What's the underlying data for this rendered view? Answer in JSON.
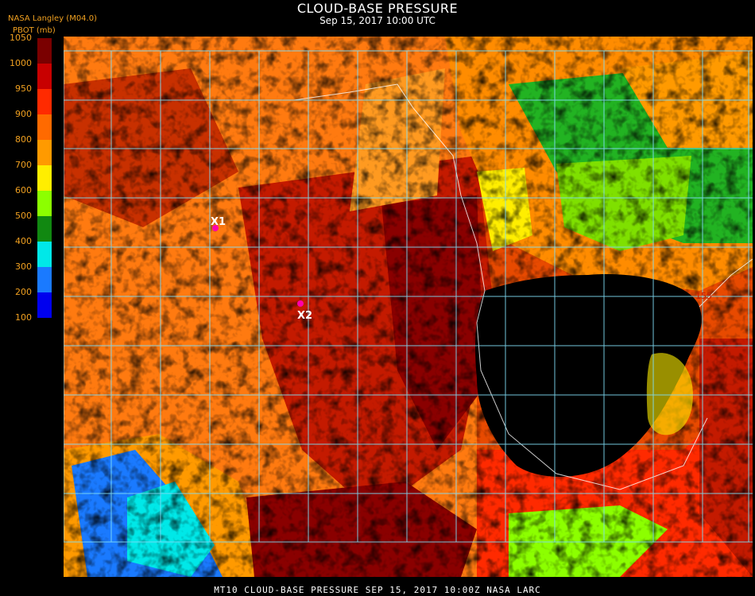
{
  "header": {
    "title": "CLOUD-BASE PRESSURE",
    "subtitle": "Sep 15, 2017 10:00 UTC",
    "provider": "NASA Langley (M04.0)",
    "units": "PBOT (mb)"
  },
  "legend": {
    "ticks": [
      "1050",
      "1000",
      "950",
      "900",
      "800",
      "700",
      "600",
      "500",
      "400",
      "300",
      "200",
      "100"
    ],
    "colors": [
      "#7a0000",
      "#c80000",
      "#ff2a00",
      "#ff6a00",
      "#ff9a00",
      "#ffee00",
      "#8cff00",
      "#118811",
      "#00e8e8",
      "#1a7aff",
      "#0000ee",
      "#8a2be2"
    ]
  },
  "map": {
    "markers": [
      {
        "label": "X1",
        "color": "#ff00aa"
      },
      {
        "label": "X2",
        "color": "#ff00aa"
      }
    ],
    "grid_labels": [
      "155"
    ],
    "grid_color": "#7fdcf5"
  },
  "footer": {
    "text": "MT10  CLOUD-BASE PRESSURE  SEP 15, 2017 10:00Z  NASA LARC"
  }
}
